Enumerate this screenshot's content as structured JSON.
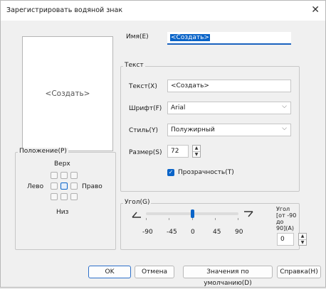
{
  "dialog": {
    "title": "Зарегистрировать водяной знак",
    "close_glyph": "✕"
  },
  "preview": {
    "text": "<Создать>"
  },
  "name": {
    "label": "Имя(E)",
    "value": "<Создать>"
  },
  "text_group": {
    "label": "Текст",
    "text_label": "Текст(X)",
    "text_value": "<Создать>",
    "font_label": "Шрифт(F)",
    "font_value": "Arial",
    "style_label": "Стиль(Y)",
    "style_value": "Полужирный",
    "size_label": "Размер(S)",
    "size_value": "72",
    "transparency_label": "Прозрачность(T)",
    "transparency_checked": true
  },
  "position_group": {
    "label": "Положение(P)",
    "top": "Верх",
    "left": "Лево",
    "right": "Право",
    "bottom": "Низ",
    "selected": "center"
  },
  "angle_group": {
    "label": "Угол(G)",
    "ticks": [
      "-90",
      "-45",
      "0",
      "45",
      "90"
    ],
    "slider_value": 0,
    "angle_label": "Угол\n[от -90 до\n90](A)",
    "angle_value": "0"
  },
  "buttons": {
    "ok": "OK",
    "cancel": "Отмена",
    "defaults": "Значения по умолчанию(D)",
    "help": "Справка(H)"
  },
  "colors": {
    "accent": "#0a64c8"
  },
  "icons": {
    "close": "close-icon",
    "chevron": "chevron-down-icon",
    "spin_up": "triangle-up-icon",
    "spin_down": "triangle-down-icon",
    "check": "checkmark-icon"
  }
}
